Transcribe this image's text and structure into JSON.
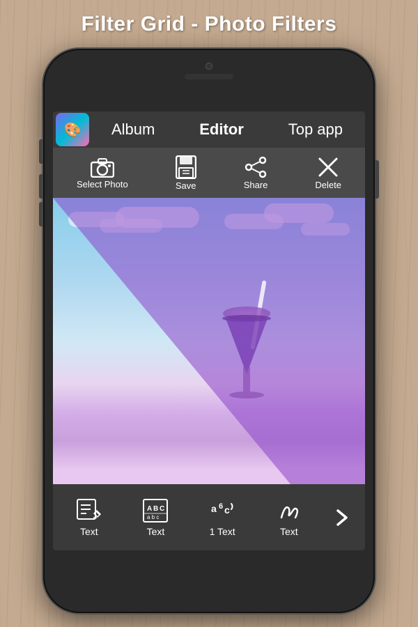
{
  "page": {
    "title": "Filter Grid - Photo Filters"
  },
  "phone": {
    "nav": {
      "tabs": [
        {
          "id": "album",
          "label": "Album"
        },
        {
          "id": "editor",
          "label": "Editor"
        },
        {
          "id": "topapp",
          "label": "Top app"
        }
      ]
    },
    "toolbar": {
      "items": [
        {
          "id": "select-photo",
          "label": "Select Photo",
          "icon": "camera"
        },
        {
          "id": "save",
          "label": "Save",
          "icon": "save"
        },
        {
          "id": "share",
          "label": "Share",
          "icon": "share"
        },
        {
          "id": "delete",
          "label": "Delete",
          "icon": "close"
        }
      ]
    },
    "bottom_bar": {
      "items": [
        {
          "id": "text-1",
          "label": "Text",
          "icon": "text-edit"
        },
        {
          "id": "text-2",
          "label": "Text",
          "icon": "text-abc"
        },
        {
          "id": "text-3",
          "label": "1 Text",
          "icon": "text-a6c"
        },
        {
          "id": "text-4",
          "label": "Text",
          "icon": "text-cursive"
        }
      ],
      "arrow": "❯"
    }
  },
  "colors": {
    "nav_bg": "#3a3a3a",
    "toolbar_bg": "#4a4a4a",
    "bottom_bg": "#3a3a3a",
    "accent_purple": "#8b46c8"
  }
}
